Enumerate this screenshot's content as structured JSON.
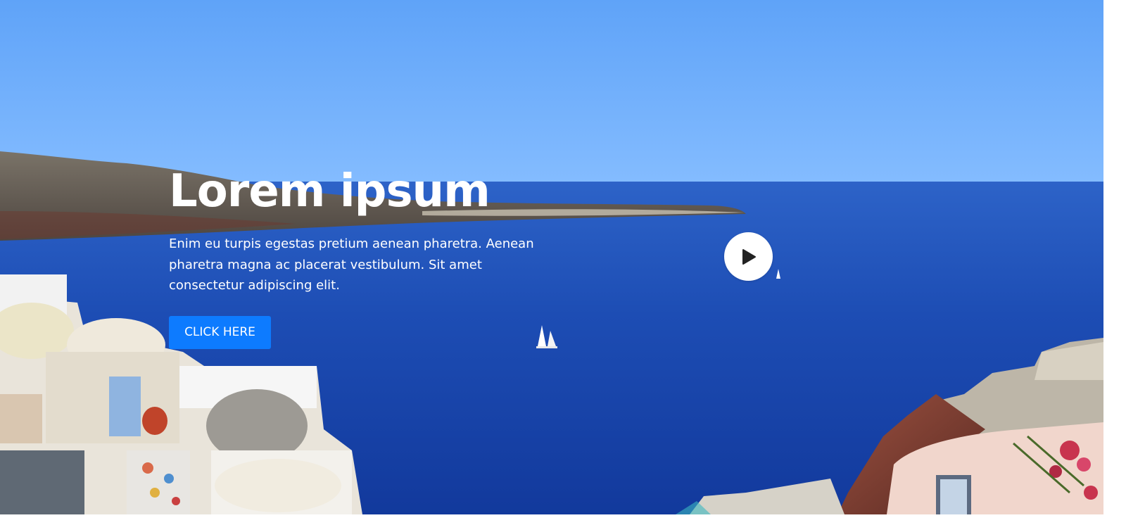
{
  "hero": {
    "title": "Lorem ipsum",
    "description": "Enim eu turpis egestas pretium aenean pharetra. Aenean pharetra magna ac placerat vestibulum. Sit amet consectetur adipiscing elit.",
    "cta_label": "CLICK HERE",
    "play_icon": "play-icon",
    "background": "santorini-sea-photo"
  },
  "colors": {
    "cta": "#0d7bff",
    "sky_top": "#5fa3f6",
    "sea": "#1a4bb0",
    "text": "#ffffff"
  }
}
